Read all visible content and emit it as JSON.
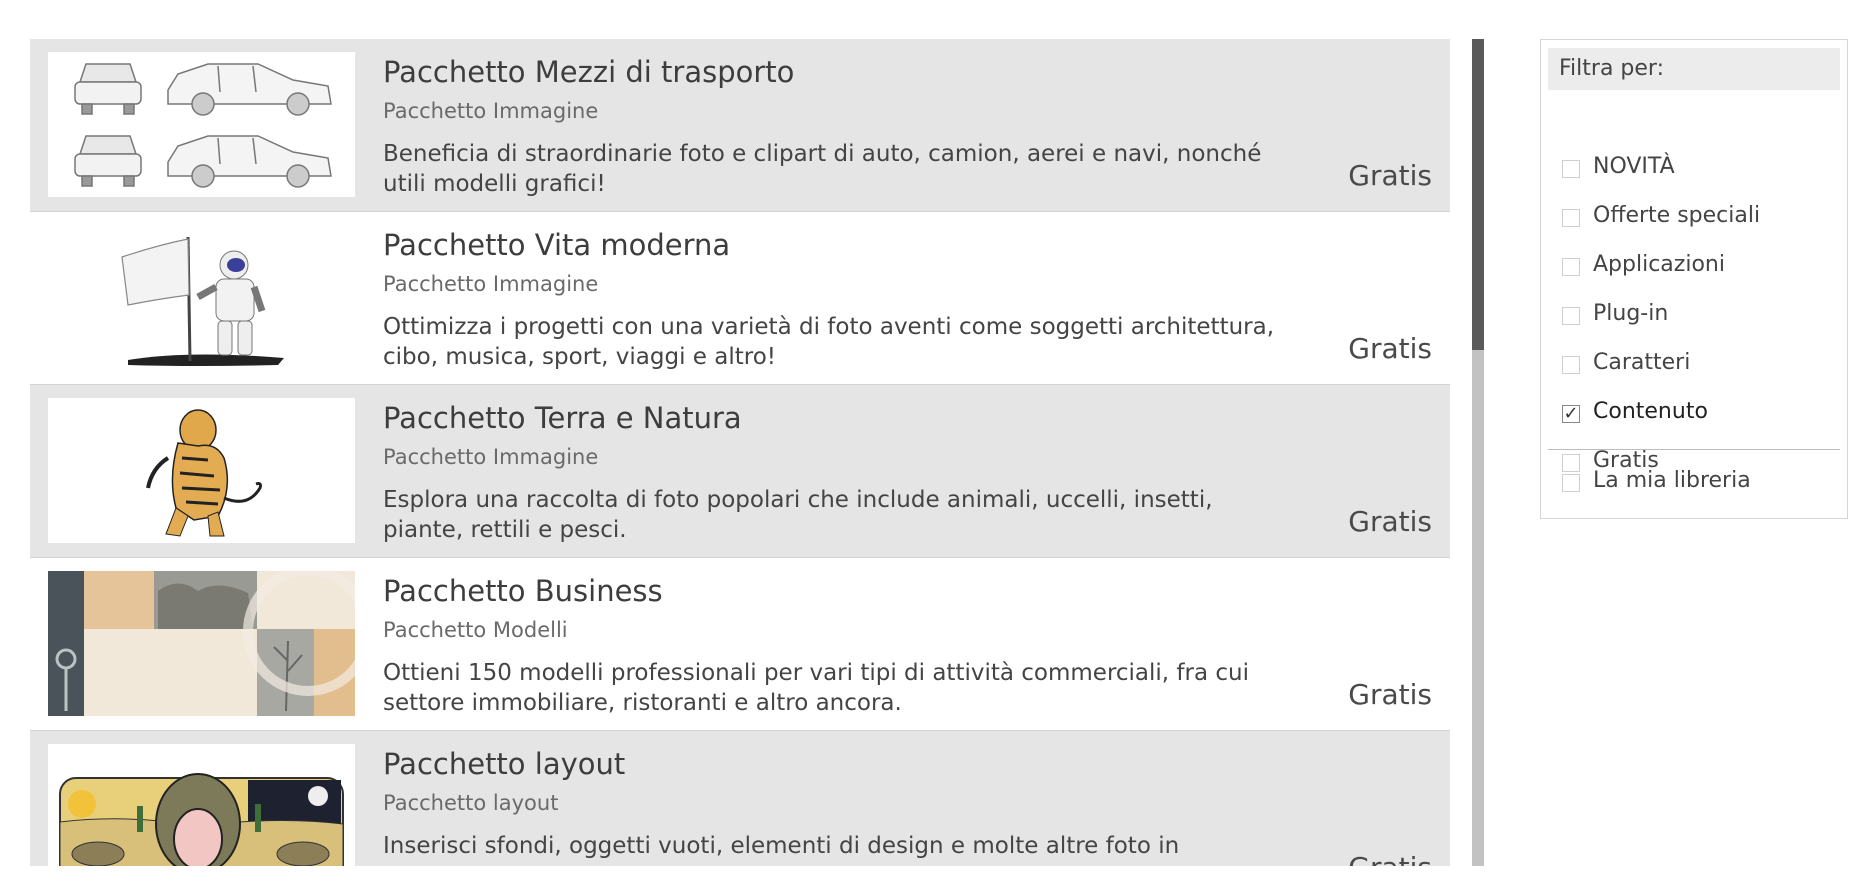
{
  "products": [
    {
      "title": "Pacchetto Mezzi di trasporto",
      "subtitle": "Pacchetto Immagine",
      "description": "Beneficia di straordinarie foto e clipart di auto, camion, aerei e navi, nonché utili modelli grafici!",
      "price": "Gratis",
      "thumbnail_icon": "cars-illustration"
    },
    {
      "title": "Pacchetto Vita moderna",
      "subtitle": "Pacchetto Immagine",
      "description": "Ottimizza i progetti con una varietà di foto aventi come soggetti architettura, cibo, musica, sport, viaggi e altro!",
      "price": "Gratis",
      "thumbnail_icon": "astronaut-flag-illustration"
    },
    {
      "title": "Pacchetto Terra e Natura",
      "subtitle": "Pacchetto Immagine",
      "description": "Esplora una raccolta di foto popolari che include animali, uccelli, insetti, piante, rettili e pesci.",
      "price": "Gratis",
      "thumbnail_icon": "tiger-illustration"
    },
    {
      "title": "Pacchetto Business",
      "subtitle": "Pacchetto Modelli",
      "description": "Ottieni 150 modelli professionali per vari tipi di attività commerciali, fra cui settore immobiliare, ristoranti e altro ancora.",
      "price": "Gratis",
      "thumbnail_icon": "business-template-collage"
    },
    {
      "title": "Pacchetto layout",
      "subtitle": "Pacchetto layout",
      "description": "Inserisci sfondi, oggetti vuoti, elementi di design e molte altre foto in",
      "price": "Gratis",
      "thumbnail_icon": "desert-snake-illustration"
    }
  ],
  "filters": {
    "header": "Filtra per:",
    "options": [
      {
        "label": "NOVITÀ",
        "checked": false
      },
      {
        "label": "Offerte speciali",
        "checked": false
      },
      {
        "label": "Applicazioni",
        "checked": false
      },
      {
        "label": "Plug-in",
        "checked": false
      },
      {
        "label": "Caratteri",
        "checked": false
      },
      {
        "label": "Contenuto",
        "checked": true
      },
      {
        "label": "Gratis",
        "checked": false
      }
    ],
    "library": {
      "label": "La mia libreria",
      "checked": false
    }
  },
  "colors": {
    "row_alt": "#e5e5e5",
    "scroll_thumb": "#5a5a5a",
    "scroll_track": "#c2c2c2"
  }
}
